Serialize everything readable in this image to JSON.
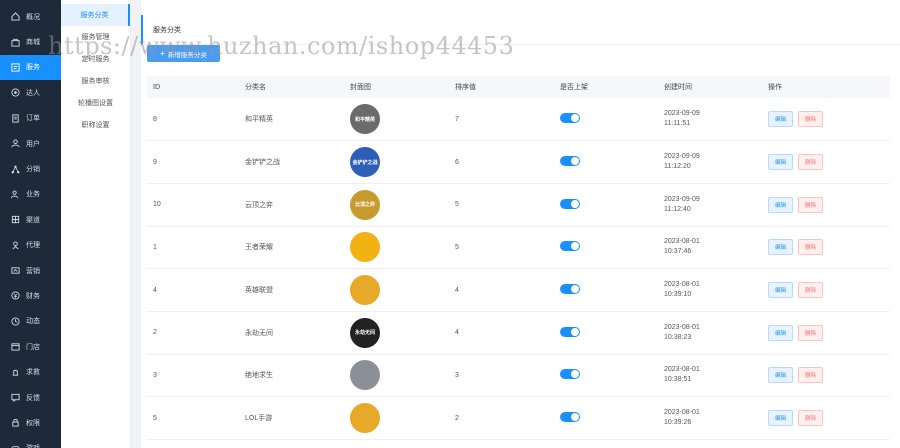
{
  "sidebar": {
    "items": [
      {
        "label": "概况",
        "icon": "home-icon"
      },
      {
        "label": "商城",
        "icon": "shop-icon"
      },
      {
        "label": "服务",
        "icon": "service-icon",
        "active": true
      },
      {
        "label": "达人",
        "icon": "expert-icon"
      },
      {
        "label": "订单",
        "icon": "order-icon"
      },
      {
        "label": "用户",
        "icon": "user-icon"
      },
      {
        "label": "分销",
        "icon": "distribution-icon"
      },
      {
        "label": "业务",
        "icon": "business-icon"
      },
      {
        "label": "渠道",
        "icon": "channel-icon"
      },
      {
        "label": "代理",
        "icon": "agent-icon"
      },
      {
        "label": "营销",
        "icon": "marketing-icon"
      },
      {
        "label": "财务",
        "icon": "finance-icon"
      },
      {
        "label": "动态",
        "icon": "dynamic-icon"
      },
      {
        "label": "门店",
        "icon": "store-icon"
      },
      {
        "label": "求救",
        "icon": "help-icon"
      },
      {
        "label": "反馈",
        "icon": "feedback-icon"
      },
      {
        "label": "权限",
        "icon": "permission-icon"
      },
      {
        "label": "游戏",
        "icon": "game-icon"
      }
    ]
  },
  "subnav": {
    "items": [
      {
        "label": "服务分类",
        "active": true
      },
      {
        "label": "服务管理"
      },
      {
        "label": "定时服务"
      },
      {
        "label": "服务审核"
      },
      {
        "label": "轮播图设置"
      },
      {
        "label": "职称设置"
      }
    ]
  },
  "card": {
    "title": "服务分类",
    "add_button": "新增服务分类"
  },
  "table": {
    "headers": [
      "ID",
      "分类名",
      "封面图",
      "排序值",
      "是否上架",
      "创建时间",
      "操作"
    ],
    "edit_label": "编辑",
    "delete_label": "删除",
    "rows": [
      {
        "id": "8",
        "name": "和平精英",
        "cover_text": "和平精英",
        "cover_color": "#6b6b6b",
        "sort": "7",
        "date": "2023-09-09",
        "time": "11:11:51"
      },
      {
        "id": "9",
        "name": "金铲铲之战",
        "cover_text": "金铲铲之战",
        "cover_color": "#2d5fb8",
        "sort": "6",
        "date": "2023-09-09",
        "time": "11:12:20"
      },
      {
        "id": "10",
        "name": "云顶之弈",
        "cover_text": "云顶之弈",
        "cover_color": "#c79a2e",
        "sort": "5",
        "date": "2023-09-09",
        "time": "11:12:40"
      },
      {
        "id": "1",
        "name": "王者荣耀",
        "cover_text": "",
        "cover_color": "#f2b213",
        "sort": "5",
        "date": "2023-08-01",
        "time": "10:37:46"
      },
      {
        "id": "4",
        "name": "英雄联盟",
        "cover_text": "",
        "cover_color": "#e8a92a",
        "sort": "4",
        "date": "2023-08-01",
        "time": "10:39:10"
      },
      {
        "id": "2",
        "name": "永劫无间",
        "cover_text": "永劫无间",
        "cover_color": "#222222",
        "sort": "4",
        "date": "2023-08-01",
        "time": "10:38:23"
      },
      {
        "id": "3",
        "name": "绝地求生",
        "cover_text": "",
        "cover_color": "#8a8f98",
        "sort": "3",
        "date": "2023-08-01",
        "time": "10:38:51"
      },
      {
        "id": "5",
        "name": "LOL手游",
        "cover_text": "",
        "cover_color": "#e8a92a",
        "sort": "2",
        "date": "2023-08-01",
        "time": "10:39:26"
      }
    ]
  },
  "watermark": "https://www.huzhan.com/ishop44453"
}
